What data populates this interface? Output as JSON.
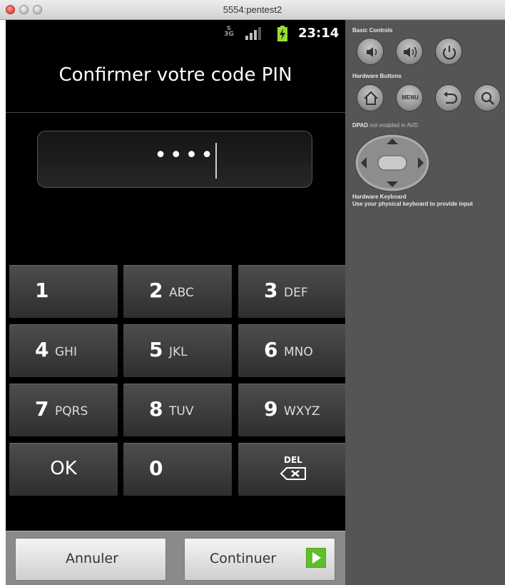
{
  "window": {
    "title": "5554:pentest2"
  },
  "status_bar": {
    "network": "3G",
    "time": "23:14"
  },
  "screen": {
    "title": "Confirmer votre code PIN",
    "pin_masked": "••••"
  },
  "keypad": [
    {
      "digit": "1",
      "letters": ""
    },
    {
      "digit": "2",
      "letters": "ABC"
    },
    {
      "digit": "3",
      "letters": "DEF"
    },
    {
      "digit": "4",
      "letters": "GHI"
    },
    {
      "digit": "5",
      "letters": "JKL"
    },
    {
      "digit": "6",
      "letters": "MNO"
    },
    {
      "digit": "7",
      "letters": "PQRS"
    },
    {
      "digit": "8",
      "letters": "TUV"
    },
    {
      "digit": "9",
      "letters": "WXYZ"
    }
  ],
  "keypad_bottom": {
    "ok": "OK",
    "zero": "0",
    "del": "DEL"
  },
  "actions": {
    "cancel": "Annuler",
    "continue": "Continuer"
  },
  "emulator_panel": {
    "basic_controls": "Basic Controls",
    "hardware_buttons": "Hardware Buttons",
    "menu_label": "MENU",
    "dpad_bold": "DPAD",
    "dpad_rest": " not enabled in AVD",
    "keyboard_title": "Hardware Keyboard",
    "keyboard_note": "Use your physical keyboard to provide input"
  },
  "colors": {
    "screen_bg": "#000000",
    "panel_bg": "#555555",
    "continue_arrow": "#5fbf2a"
  }
}
